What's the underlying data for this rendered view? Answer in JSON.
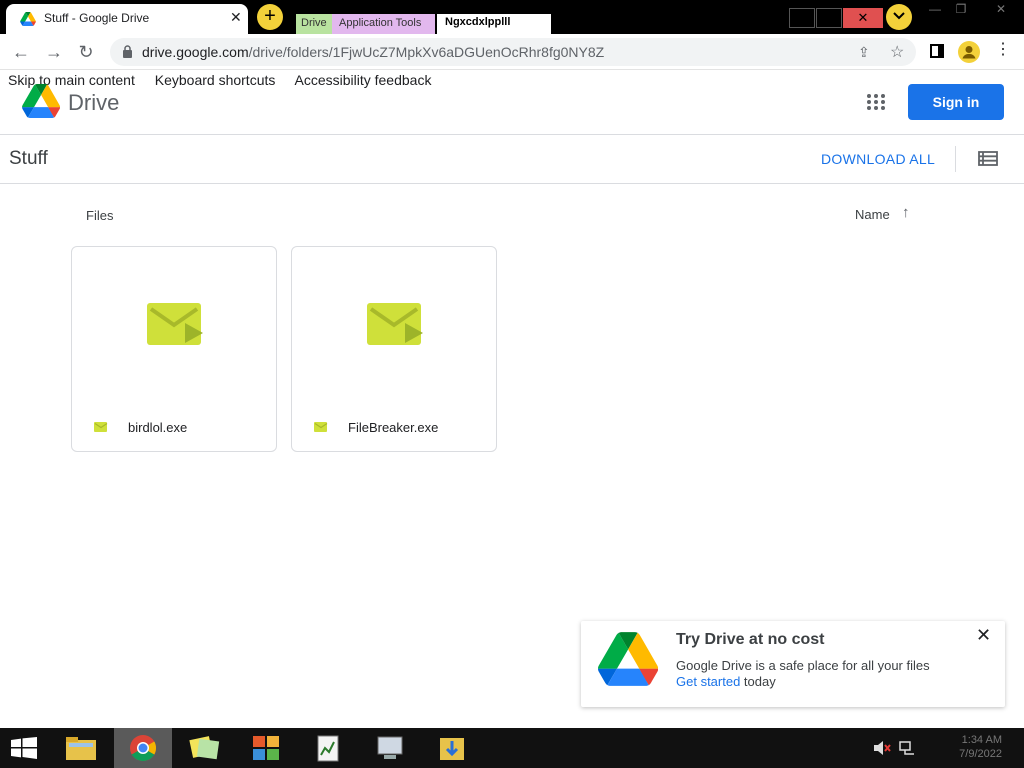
{
  "browser": {
    "tab_title": "Stuff - Google Drive",
    "tab_strip": {
      "drive_label": "Drive",
      "app_tools_label": "Application Tools",
      "garbled_label": "Ngxcdxlpplll"
    },
    "url": {
      "host": "drive.google.com",
      "path": "/drive/folders/1FjwUcZ7MpkXv6aDGUenOcRhr8fg0NY8Z"
    }
  },
  "drive": {
    "skip_links": [
      "Skip to main content",
      "Keyboard shortcuts",
      "Accessibility feedback"
    ],
    "product_name": "Drive",
    "sign_in_label": "Sign in",
    "folder_title": "Stuff",
    "download_all_label": "DOWNLOAD ALL",
    "files_section_label": "Files",
    "sort_label": "Name",
    "files": [
      {
        "name": "birdlol.exe"
      },
      {
        "name": "FileBreaker.exe"
      }
    ]
  },
  "promo": {
    "title": "Try Drive at no cost",
    "text": "Google Drive is a safe place for all your files",
    "link_label": "Get started",
    "link_suffix": " today"
  },
  "taskbar": {
    "clock_time": "1:34 AM",
    "clock_date": "7/9/2022"
  },
  "colors": {
    "accent_blue": "#1a73e8",
    "file_icon_green": "#cfe03a",
    "tab_yellow": "#f3d13a"
  }
}
